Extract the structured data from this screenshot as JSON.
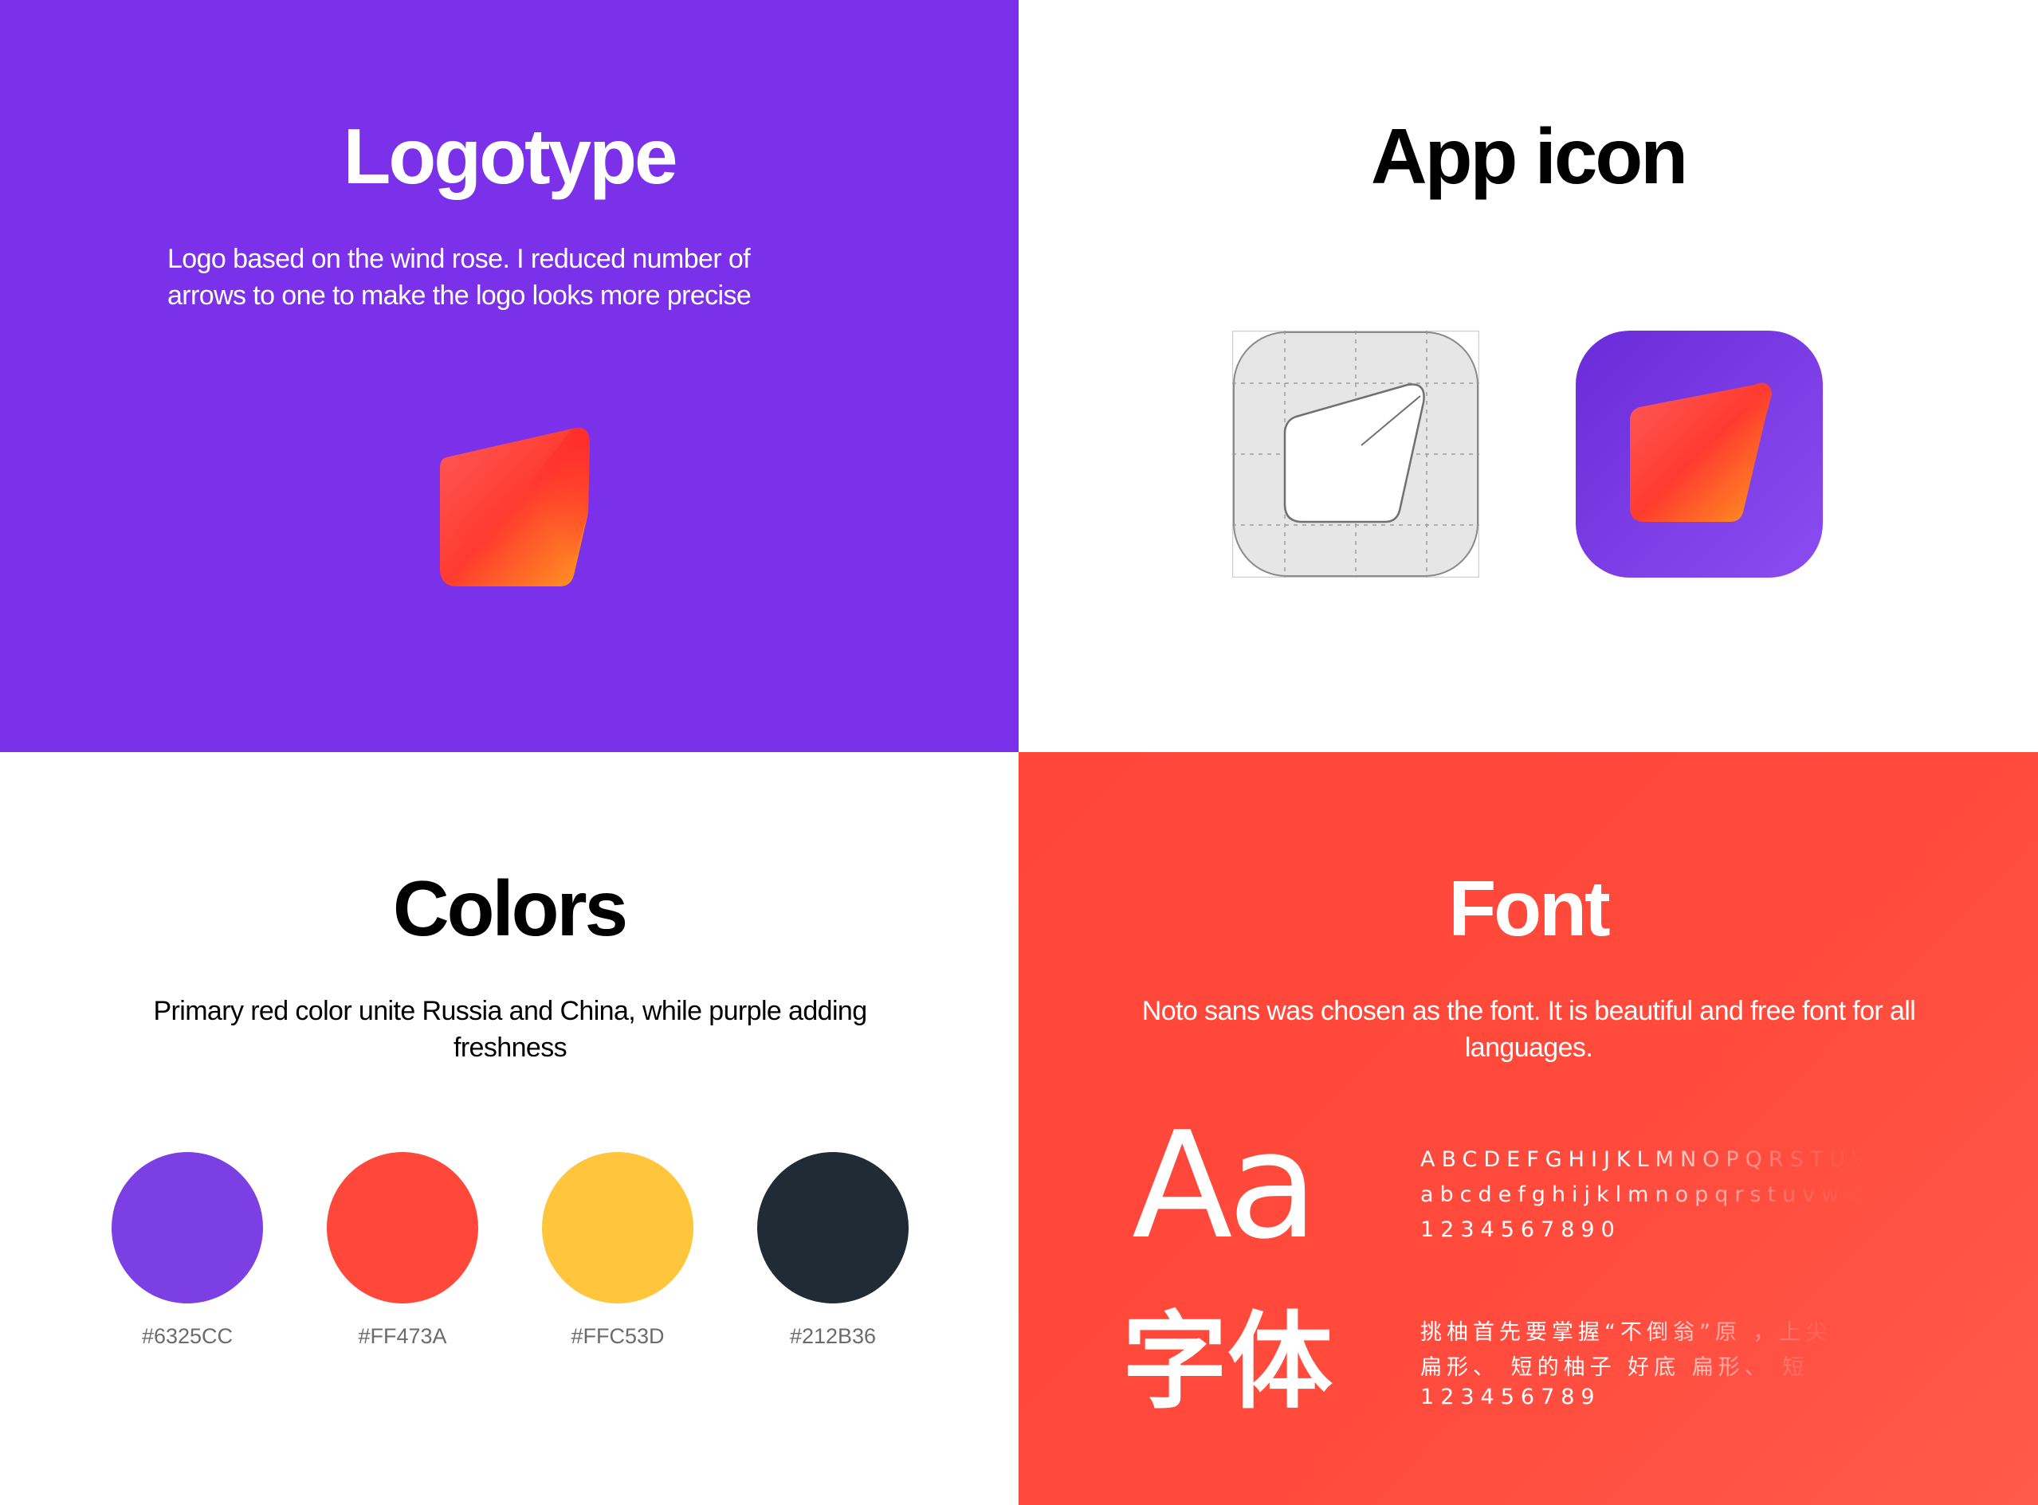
{
  "logotype": {
    "title": "Logotype",
    "description": "Logo based on the wind rose. I reduced number of arrows to one to make the logo looks more precise",
    "logo_icon": "wind-rose-arrow-mark"
  },
  "app_icon": {
    "title": "App icon",
    "grid_icon": "app-icon-construction-grid",
    "final_icon": "app-icon-purple"
  },
  "colors": {
    "title": "Colors",
    "description": "Primary red color unite Russia and China, while purple adding freshness",
    "swatches": [
      {
        "label": "#6325CC",
        "color": "#7B3FE4"
      },
      {
        "label": "#FF473A",
        "color": "#FF473A"
      },
      {
        "label": "#FFC53D",
        "color": "#FFC53D"
      },
      {
        "label": "#212B36",
        "color": "#212B36"
      }
    ]
  },
  "font": {
    "title": "Font",
    "description": "Noto sans was chosen as the font. It is beautiful and free font for all languages.",
    "latin_sample": "Aa",
    "cjk_sample": "字体",
    "latin_lines": [
      "ABCDEFGHIJKLMNOPQRSTUVW",
      "abcdefghijklmnopqrstuvwxyz",
      "1234567890"
    ],
    "cjk_lines": [
      "挑柚首先要掌握“不倒翁”原 ，上尖",
      "扁形、 短的柚子 好底 扁形、 短",
      "123456789"
    ]
  },
  "palette": {
    "logo_bg": "#7B31EA",
    "font_bg": "#FF4639"
  }
}
